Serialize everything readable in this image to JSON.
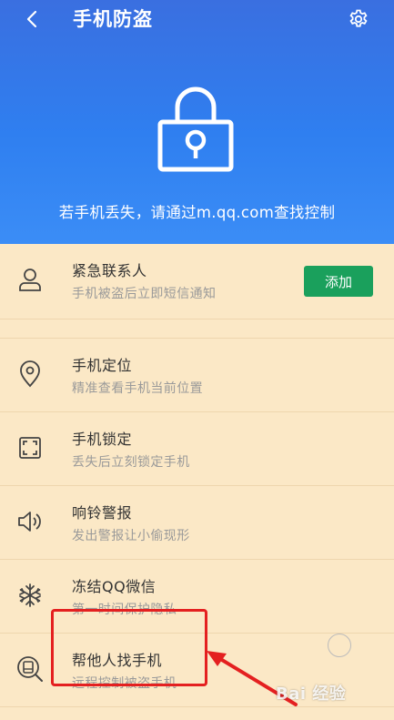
{
  "header": {
    "title": "手机防盗",
    "hint": "若手机丢失，请通过m.qq.com查找控制",
    "icons": {
      "back": "chevron-left-icon",
      "settings": "gear-icon",
      "lock": "lock-icon"
    }
  },
  "emergency": {
    "title": "紧急联系人",
    "subtitle": "手机被盗后立即短信通知",
    "add_label": "添加",
    "icon": "person-icon"
  },
  "features": [
    {
      "title": "手机定位",
      "subtitle": "精准查看手机当前位置",
      "icon": "location-pin-icon"
    },
    {
      "title": "手机锁定",
      "subtitle": "丢失后立刻锁定手机",
      "icon": "screen-lock-icon"
    },
    {
      "title": "响铃警报",
      "subtitle": "发出警报让小偷现形",
      "icon": "speaker-alarm-icon"
    },
    {
      "title": "冻结QQ微信",
      "subtitle": "第一时间保护隐私",
      "icon": "snowflake-icon"
    },
    {
      "title": "帮他人找手机",
      "subtitle": "远程控制被盗手机",
      "icon": "phone-search-icon"
    }
  ],
  "watermark": "Bai 经验",
  "colors": {
    "accent_green": "#1aa05c",
    "header_blue": "#2f7ff0",
    "highlight_red": "#e42020"
  }
}
